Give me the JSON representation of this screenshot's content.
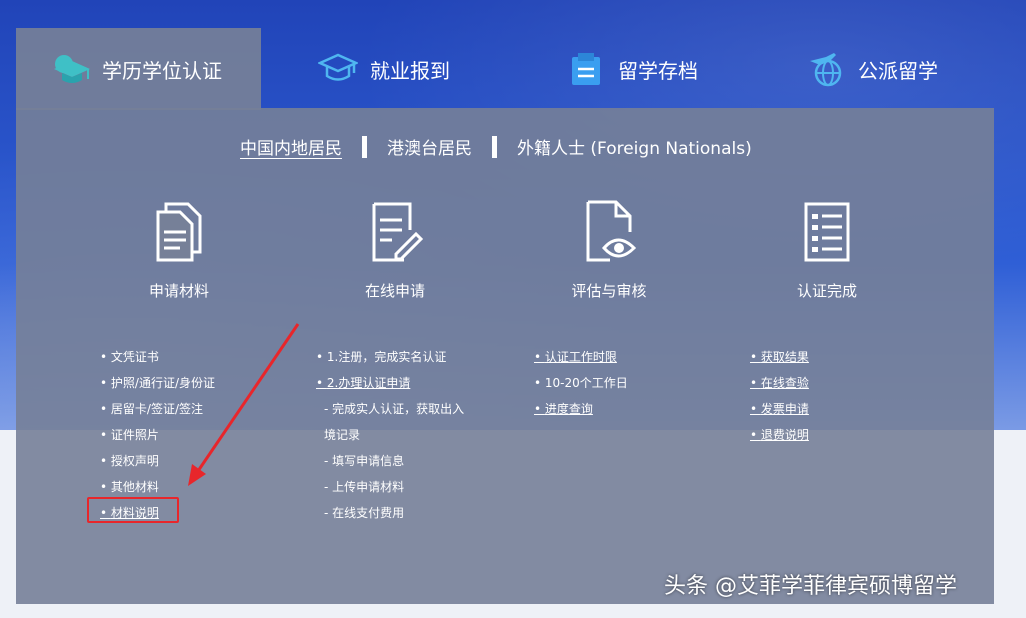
{
  "top_tabs": [
    {
      "label": "学历学位认证",
      "icon": "graduation-cap-icon",
      "active": true
    },
    {
      "label": "就业报到",
      "icon": "academic-cap-icon",
      "active": false
    },
    {
      "label": "留学存档",
      "icon": "archive-icon",
      "active": false
    },
    {
      "label": "公派留学",
      "icon": "airplane-globe-icon",
      "active": false
    }
  ],
  "region_tabs": [
    {
      "label": "中国内地居民",
      "active": true
    },
    {
      "label": "港澳台居民",
      "active": false
    },
    {
      "label": "外籍人士 (Foreign Nationals)",
      "active": false
    }
  ],
  "steps": [
    {
      "title": "申请材料",
      "icon": "documents-icon"
    },
    {
      "title": "在线申请",
      "icon": "form-edit-icon"
    },
    {
      "title": "评估与审核",
      "icon": "document-eye-icon"
    },
    {
      "title": "认证完成",
      "icon": "checklist-icon"
    }
  ],
  "lists": {
    "materials": [
      "文凭证书",
      "护照/通行证/身份证",
      "居留卡/签证/签注",
      "证件照片",
      "授权声明",
      "其他材料",
      "材料说明"
    ],
    "online": {
      "items": [
        "1.注册，完成实名认证",
        "2.办理认证申请"
      ],
      "subs": [
        "完成实人认证，获取出入境记录",
        "填写申请信息",
        "上传申请材料",
        "在线支付费用"
      ]
    },
    "review": [
      "认证工作时限",
      "10-20个工作日",
      "进度查询"
    ],
    "complete": [
      "获取结果",
      "在线查验",
      "发票申请",
      "退费说明"
    ]
  },
  "watermark": "头条 @艾菲学菲律宾硕博留学",
  "colors": {
    "panel": "#767f98",
    "accent_red": "#e8262b",
    "bg_blue": "#2f5fd6"
  }
}
